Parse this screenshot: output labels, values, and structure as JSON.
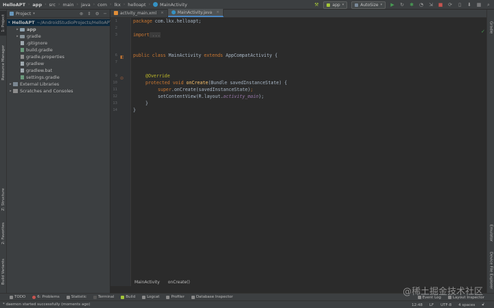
{
  "breadcrumbs": [
    "HelloAPT",
    "app",
    "src",
    "main",
    "java",
    "com",
    "lkx",
    "helloapt",
    "MainActivity"
  ],
  "toolbar": {
    "run_config": "app",
    "device": "AutoSize"
  },
  "project_panel": {
    "title": "Project",
    "tree": [
      {
        "indent": 0,
        "arrow": "▾",
        "icon": "module",
        "label": "HelloAPT",
        "path": "~/AndroidStudioProjects/HelloAPT",
        "selected": true,
        "bold": true
      },
      {
        "indent": 1,
        "arrow": "▸",
        "icon": "module",
        "label": "app",
        "bold": true
      },
      {
        "indent": 1,
        "arrow": "▸",
        "icon": "folder",
        "label": "gradle"
      },
      {
        "indent": 1,
        "arrow": "",
        "icon": "file",
        "label": ".gitignore"
      },
      {
        "indent": 1,
        "arrow": "",
        "icon": "gradle",
        "label": "build.gradle"
      },
      {
        "indent": 1,
        "arrow": "",
        "icon": "props",
        "label": "gradle.properties"
      },
      {
        "indent": 1,
        "arrow": "",
        "icon": "file",
        "label": "gradlew"
      },
      {
        "indent": 1,
        "arrow": "",
        "icon": "file",
        "label": "gradlew.bat"
      },
      {
        "indent": 1,
        "arrow": "",
        "icon": "gradle",
        "label": "settings.gradle"
      },
      {
        "indent": 0,
        "arrow": "▸",
        "icon": "lib",
        "label": "External Libraries"
      },
      {
        "indent": 0,
        "arrow": "▸",
        "icon": "scratch",
        "label": "Scratches and Consoles"
      }
    ]
  },
  "left_tabs": {
    "project": "1: Project",
    "resource_manager": "Resource Manager",
    "structure": "Z: Structure",
    "favorites": "2: Favorites",
    "build_variants": "Build Variants"
  },
  "right_tabs": {
    "gradle": "Gradle",
    "emulator": "Emulator",
    "device_file_explorer": "Device File Explorer"
  },
  "editor": {
    "tabs": [
      {
        "label": "activity_main.xml",
        "active": false
      },
      {
        "label": "MainActivity.java",
        "active": true
      }
    ],
    "line_numbers": [
      "1",
      "2",
      "3",
      "",
      "6",
      "7",
      "",
      "9",
      "10",
      "11",
      "12",
      "13",
      "14"
    ],
    "code": {
      "l1_kw": "package",
      "l1_rest": " com.lkx.helloapt;",
      "l3_kw": "import",
      "l3_fold": " ...",
      "l6_kw1": "public class",
      "l6_name": " MainActivity ",
      "l6_kw2": "extends",
      "l6_super": " AppCompatActivity {",
      "l9_ann": "@Override",
      "l10_kw": "protected void",
      "l10_mth": " onCreate",
      "l10_rest": "(Bundle savedInstanceState) {",
      "l11_kw": "super",
      "l11_rest": ".onCreate(savedInstanceState)",
      "l11_semi": ";",
      "l12_pre": "setContentView(R.layout.",
      "l12_fld": "activity_main",
      "l12_post": ");",
      "l13": "}",
      "l14": "}"
    },
    "breadcrumb": [
      "MainActivity",
      "onCreate()"
    ]
  },
  "bottom_tools": [
    "TODO",
    "6: Problems",
    "Statistic",
    "Terminal",
    "Build",
    "Logcat",
    "Profiler",
    "Database Inspector"
  ],
  "bottom_right_tools": [
    "Event Log",
    "Layout Inspector"
  ],
  "status": {
    "message": "* daemon started successfully (moments ago)",
    "position": "12:48",
    "line_sep": "LF",
    "encoding": "UTF-8",
    "indent": "4 spaces"
  },
  "watermark": "@稀土掘金技术社区",
  "colors": {
    "keyword": "#cc7832",
    "method": "#ffc66d",
    "annotation": "#bbb529",
    "field": "#9876aa",
    "text": "#a9b7c6"
  }
}
